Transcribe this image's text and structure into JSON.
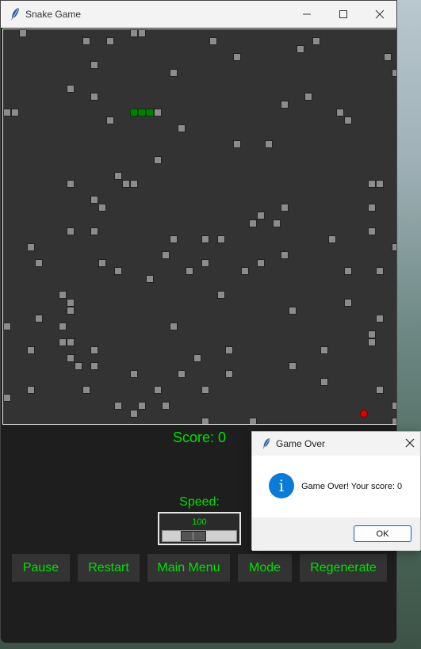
{
  "window": {
    "title": "Snake Game"
  },
  "board": {
    "grid_size": 10,
    "colors": {
      "background": "#333333",
      "obstacle_fill": "#8c8c8c",
      "obstacle_border": "#222222",
      "snake_fill": "#008000",
      "snake_border": "#004000",
      "food": "#e00000"
    },
    "snake": [
      [
        16,
        10
      ],
      [
        17,
        10
      ],
      [
        18,
        10
      ]
    ],
    "snake_tail_block": [
      19,
      10
    ],
    "food": [
      45,
      48
    ],
    "obstacles": [
      [
        2,
        0
      ],
      [
        16,
        0
      ],
      [
        17,
        0
      ],
      [
        10,
        1
      ],
      [
        13,
        1
      ],
      [
        26,
        1
      ],
      [
        39,
        1
      ],
      [
        37,
        2
      ],
      [
        29,
        3
      ],
      [
        48,
        3
      ],
      [
        11,
        4
      ],
      [
        21,
        5
      ],
      [
        49,
        5
      ],
      [
        8,
        7
      ],
      [
        11,
        8
      ],
      [
        38,
        8
      ],
      [
        35,
        9
      ],
      [
        0,
        10
      ],
      [
        1,
        10
      ],
      [
        42,
        10
      ],
      [
        13,
        11
      ],
      [
        43,
        11
      ],
      [
        22,
        12
      ],
      [
        29,
        14
      ],
      [
        33,
        14
      ],
      [
        19,
        16
      ],
      [
        14,
        18
      ],
      [
        8,
        19
      ],
      [
        15,
        19
      ],
      [
        16,
        19
      ],
      [
        46,
        19
      ],
      [
        47,
        19
      ],
      [
        11,
        21
      ],
      [
        12,
        22
      ],
      [
        35,
        22
      ],
      [
        46,
        22
      ],
      [
        32,
        23
      ],
      [
        31,
        24
      ],
      [
        34,
        24
      ],
      [
        8,
        25
      ],
      [
        11,
        25
      ],
      [
        46,
        25
      ],
      [
        21,
        26
      ],
      [
        25,
        26
      ],
      [
        27,
        26
      ],
      [
        41,
        26
      ],
      [
        3,
        27
      ],
      [
        49,
        27
      ],
      [
        20,
        28
      ],
      [
        35,
        28
      ],
      [
        4,
        29
      ],
      [
        12,
        29
      ],
      [
        25,
        29
      ],
      [
        32,
        29
      ],
      [
        14,
        30
      ],
      [
        23,
        30
      ],
      [
        30,
        30
      ],
      [
        43,
        30
      ],
      [
        47,
        30
      ],
      [
        18,
        31
      ],
      [
        7,
        33
      ],
      [
        27,
        33
      ],
      [
        8,
        34
      ],
      [
        43,
        34
      ],
      [
        8,
        35
      ],
      [
        36,
        35
      ],
      [
        4,
        36
      ],
      [
        47,
        36
      ],
      [
        0,
        37
      ],
      [
        7,
        37
      ],
      [
        21,
        37
      ],
      [
        46,
        38
      ],
      [
        7,
        39
      ],
      [
        8,
        39
      ],
      [
        46,
        39
      ],
      [
        3,
        40
      ],
      [
        11,
        40
      ],
      [
        28,
        40
      ],
      [
        40,
        40
      ],
      [
        8,
        41
      ],
      [
        24,
        41
      ],
      [
        9,
        42
      ],
      [
        11,
        42
      ],
      [
        36,
        42
      ],
      [
        16,
        43
      ],
      [
        22,
        43
      ],
      [
        28,
        43
      ],
      [
        40,
        44
      ],
      [
        3,
        45
      ],
      [
        10,
        45
      ],
      [
        19,
        45
      ],
      [
        25,
        45
      ],
      [
        47,
        45
      ],
      [
        0,
        46
      ],
      [
        14,
        47
      ],
      [
        17,
        47
      ],
      [
        20,
        47
      ],
      [
        49,
        47
      ],
      [
        16,
        48
      ],
      [
        25,
        49
      ],
      [
        31,
        49
      ],
      [
        49,
        49
      ]
    ]
  },
  "score": {
    "text": "Score: 0"
  },
  "speed": {
    "label": "Speed:",
    "value": "100",
    "fraction": 0.2
  },
  "buttons": {
    "pause": "Pause",
    "restart": "Restart",
    "main_menu": "Main Menu",
    "mode": "Mode",
    "regenerate": "Regenerate"
  },
  "dialog": {
    "title": "Game Over",
    "message": "Game Over! Your score: 0",
    "ok": "OK"
  },
  "colors": {
    "accent_text": "#00e000",
    "window_bg": "#1e1e1e",
    "button_bg": "#333333",
    "dialog_info": "#0a7bd6"
  }
}
